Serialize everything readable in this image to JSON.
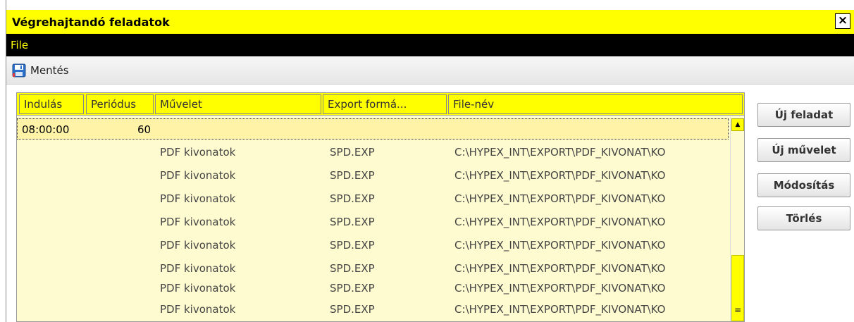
{
  "window": {
    "title": "Végrehajtandó feladatok",
    "close_label": "×"
  },
  "menu": {
    "file_label": "File"
  },
  "toolbar": {
    "save_label": "Mentés",
    "save_icon": "floppy-disk-icon"
  },
  "table": {
    "columns": [
      "Indulás",
      "Periódus",
      "Művelet",
      "Export formá...",
      "File-név"
    ],
    "group_row": {
      "start": "08:00:00",
      "period": "60"
    },
    "rows": [
      {
        "operation": "PDF kivonatok",
        "format": "SPD.EXP",
        "filename": "C:\\HYPEX_INT\\EXPORT\\PDF_KIVONAT\\KO"
      },
      {
        "operation": "PDF kivonatok",
        "format": "SPD.EXP",
        "filename": "C:\\HYPEX_INT\\EXPORT\\PDF_KIVONAT\\KO"
      },
      {
        "operation": "PDF kivonatok",
        "format": "SPD.EXP",
        "filename": "C:\\HYPEX_INT\\EXPORT\\PDF_KIVONAT\\KO"
      },
      {
        "operation": "PDF kivonatok",
        "format": "SPD.EXP",
        "filename": "C:\\HYPEX_INT\\EXPORT\\PDF_KIVONAT\\KO"
      },
      {
        "operation": "PDF kivonatok",
        "format": "SPD.EXP",
        "filename": "C:\\HYPEX_INT\\EXPORT\\PDF_KIVONAT\\KO"
      },
      {
        "operation": "PDF kivonatok",
        "format": "SPD.EXP",
        "filename": "C:\\HYPEX_INT\\EXPORT\\PDF_KIVONAT\\KO"
      },
      {
        "operation": "PDF kivonatok",
        "format": "SPD.EXP",
        "filename": "C:\\HYPEX_INT\\EXPORT\\PDF_KIVONAT\\KO"
      },
      {
        "operation": "PDF kivonatok",
        "format": "SPD.EXP",
        "filename": "C:\\HYPEX_INT\\EXPORT\\PDF_KIVONAT\\KO"
      }
    ]
  },
  "actions": {
    "new_task": "Új feladat",
    "new_operation": "Új művelet",
    "modify": "Módosítás",
    "delete": "Törlés"
  },
  "colors": {
    "accent": "#ffff00",
    "menubar": "#000000",
    "grid_bg": "#fffbd0"
  }
}
